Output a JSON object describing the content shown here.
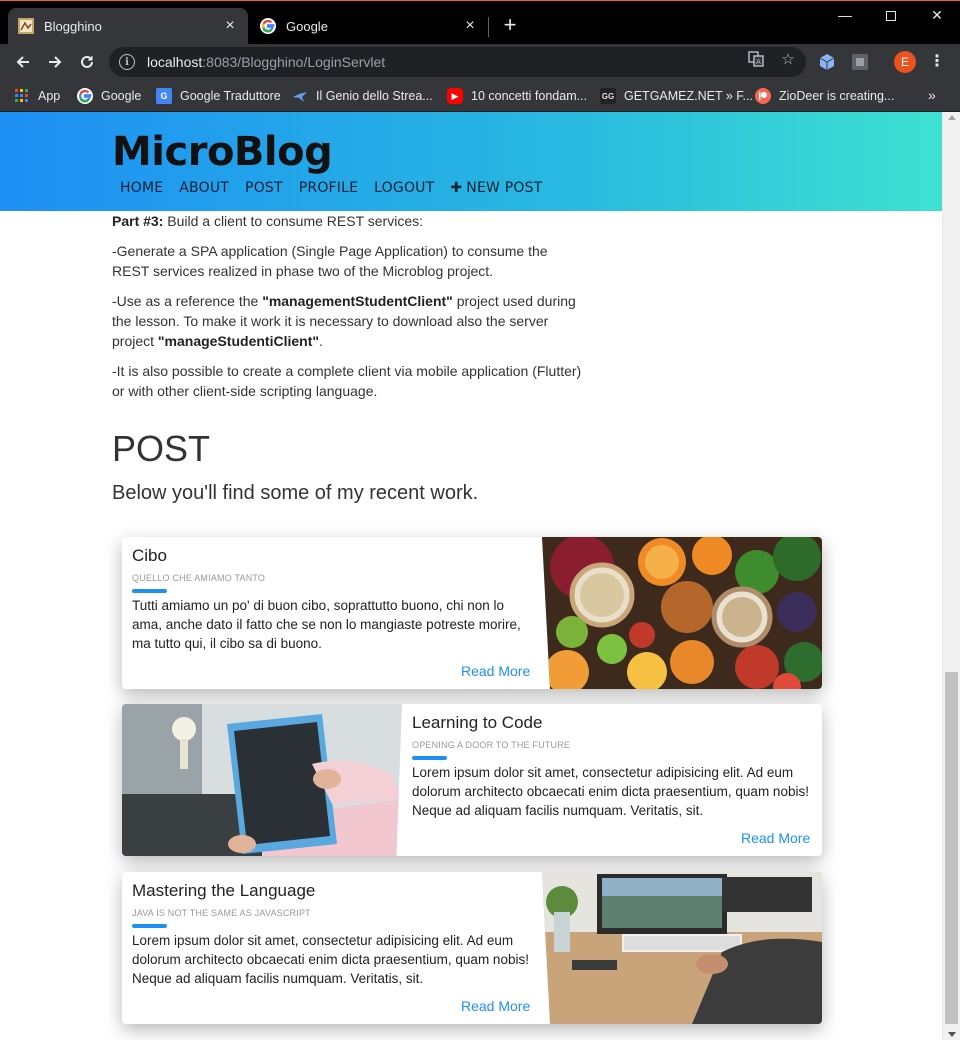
{
  "browser": {
    "tabs": [
      {
        "title": "Blogghino",
        "active": true
      },
      {
        "title": "Google",
        "active": false
      }
    ],
    "url_host": "localhost",
    "url_path": ":8083/Blogghino/LoginServlet",
    "profile_initial": "E",
    "bookmarks": [
      {
        "label": "App",
        "icon": "apps-grid-icon"
      },
      {
        "label": "Google",
        "icon": "google-icon"
      },
      {
        "label": "Google Traduttore",
        "icon": "google-translate-icon"
      },
      {
        "label": "Il Genio dello Strea...",
        "icon": "bird-icon"
      },
      {
        "label": "10 concetti fondam...",
        "icon": "youtube-icon"
      },
      {
        "label": "GETGAMEZ.NET » F...",
        "icon": "getgamez-icon"
      },
      {
        "label": "ZioDeer is creating...",
        "icon": "patreon-icon"
      }
    ],
    "colors": {
      "accent": "#e8710a",
      "chrome_bg": "#35363a"
    }
  },
  "site": {
    "brand": "MicroBlog",
    "nav": [
      "HOME",
      "ABOUT",
      "POST",
      "PROFILE",
      "LOGOUT",
      "NEW POST"
    ],
    "new_post_icon": "plus-icon",
    "colors": {
      "gradient_start": "#1e8ff5",
      "gradient_end": "#3ee1d1",
      "link": "#1e8ff5"
    }
  },
  "content": {
    "part3_label": "Part #3:",
    "part3_text": " Build a client to consume REST services:",
    "p1": "-Generate a SPA application (Single Page Application) to consume the REST services realized in phase two of the Microblog project.",
    "p2_a": "-Use as a reference the ",
    "p2_b": "\"managementStudentClient\"",
    "p2_c": " project used during the lesson. To make it work it is necessary to download also the server project ",
    "p2_d": "\"manageStudentiClient\"",
    "p2_e": ".",
    "p3": "-It is also possible to create a complete client via mobile application (Flutter) or with other client-side scripting language."
  },
  "post_section": {
    "heading": "POST",
    "subheading": "Below you'll find some of my recent work."
  },
  "cards": [
    {
      "title": "Cibo",
      "kicker": "QUELLO CHE AMIAMO TANTO",
      "text": "Tutti amiamo un po' di buon cibo, soprattutto buono, chi non lo ama, anche dato il fatto che se non lo mangiaste potreste morire, ma tutto qui, il cibo sa di buono.",
      "link": "Read More",
      "image": "fruits-vegetables-photo"
    },
    {
      "title": "Learning to Code",
      "kicker": "OPENING A DOOR TO THE FUTURE",
      "text": "Lorem ipsum dolor sit amet, consectetur adipisicing elit. Ad eum dolorum architecto obcaecati enim dicta praesentium, quam nobis! Neque ad aliquam facilis numquam. Veritatis, sit.",
      "link": "Read More",
      "image": "tablet-hands-photo"
    },
    {
      "title": "Mastering the Language",
      "kicker": "JAVA IS NOT THE SAME AS JAVASCRIPT",
      "text": "Lorem ipsum dolor sit amet, consectetur adipisicing elit. Ad eum dolorum architecto obcaecati enim dicta praesentium, quam nobis! Neque ad aliquam facilis numquam. Veritatis, sit.",
      "link": "Read More",
      "image": "desk-computer-photo"
    }
  ]
}
